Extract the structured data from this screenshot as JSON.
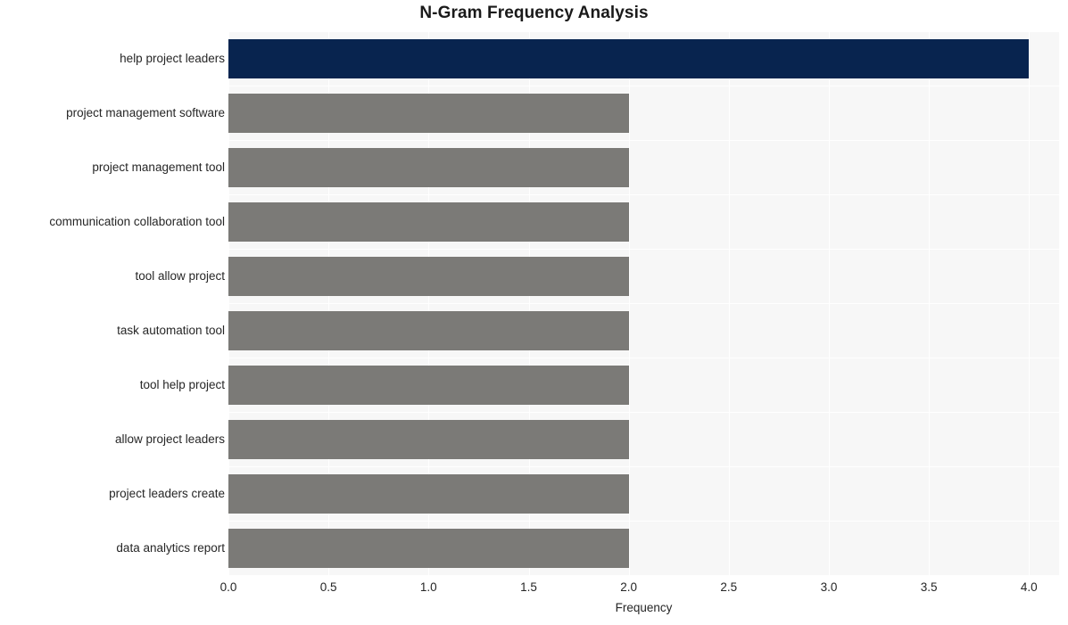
{
  "chart_data": {
    "type": "bar",
    "orientation": "horizontal",
    "title": "N-Gram Frequency Analysis",
    "xlabel": "Frequency",
    "ylabel": "",
    "categories": [
      "help project leaders",
      "project management software",
      "project management tool",
      "communication collaboration tool",
      "tool allow project",
      "task automation tool",
      "tool help project",
      "allow project leaders",
      "project leaders create",
      "data analytics report"
    ],
    "values": [
      4,
      2,
      2,
      2,
      2,
      2,
      2,
      2,
      2,
      2
    ],
    "bar_colors": [
      "#08244f",
      "#7b7a77",
      "#7b7a77",
      "#7b7a77",
      "#7b7a77",
      "#7b7a77",
      "#7b7a77",
      "#7b7a77",
      "#7b7a77",
      "#7b7a77"
    ],
    "xlim": [
      0,
      4.15
    ],
    "xticks": [
      0,
      0.5,
      1,
      1.5,
      2,
      2.5,
      3,
      3.5,
      4
    ],
    "xticklabels": [
      "0.0",
      "0.5",
      "1.0",
      "1.5",
      "2.0",
      "2.5",
      "3.0",
      "3.5",
      "4.0"
    ],
    "grid": true,
    "legend": false,
    "plot_background": "#f7f7f7",
    "grid_color": "#ffffff",
    "figure_background": "#ffffff",
    "highlight_color": "#08244f",
    "default_color": "#7b7a77"
  }
}
